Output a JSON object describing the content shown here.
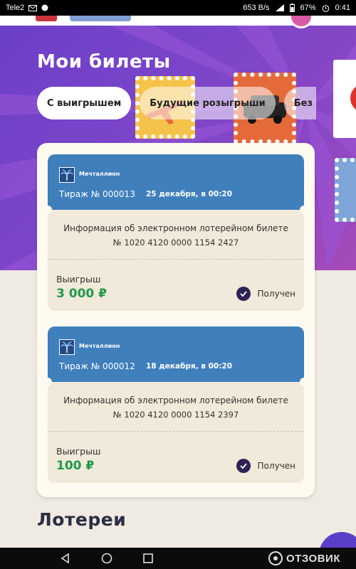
{
  "status_bar": {
    "carrier": "Tele2",
    "speed": "653 B/s",
    "battery": "67%",
    "time": "0:41"
  },
  "page": {
    "title": "Мои билеты"
  },
  "tabs": [
    {
      "label": "С выигрышем",
      "active": true
    },
    {
      "label": "Будущие розыгрыши",
      "active": false
    },
    {
      "label": "Без выи",
      "active": false
    }
  ],
  "tickets": [
    {
      "brand": "Мечталлион",
      "draw": "Тираж № 000013",
      "date": "25 декабря, в 00:20",
      "info_title": "Информация об электронном лотерейном билете",
      "number": "№ 1020 4120 0000 1154 2427",
      "win_label": "Выигрыш",
      "amount": "3 000 ₽",
      "status": "Получен"
    },
    {
      "brand": "Мечталлион",
      "draw": "Тираж № 000012",
      "date": "18 декабря, в 00:20",
      "info_title": "Информация об электронном лотерейном билете",
      "number": "№ 1020 4120 0000 1154 2397",
      "win_label": "Выигрыш",
      "amount": "100 ₽",
      "status": "Получен"
    }
  ],
  "section": {
    "title": "Лотереи"
  },
  "watermark": {
    "text": "ОТЗОВИК"
  },
  "icons": {
    "back": "back-triangle-icon",
    "home": "home-circle-icon",
    "recents": "recents-square-icon",
    "check": "check-icon",
    "logo": "palm-tree-icon"
  },
  "colors": {
    "ticket_header": "#3f7fbc",
    "amount_green": "#1f9a4a",
    "check_dark": "#2e2356",
    "hero_purple": "#7a45c9"
  }
}
